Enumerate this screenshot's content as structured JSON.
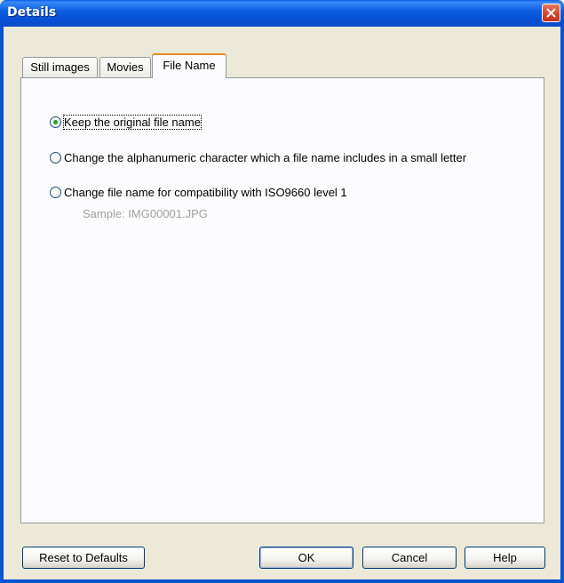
{
  "window": {
    "title": "Details",
    "close_icon": "close-icon"
  },
  "tabs": [
    {
      "label": "Still images",
      "active": false
    },
    {
      "label": "Movies",
      "active": false
    },
    {
      "label": "File Name",
      "active": true
    }
  ],
  "options": [
    {
      "label": "Keep the original file name",
      "checked": true
    },
    {
      "label": "Change the alphanumeric character which a file name includes in a small letter",
      "checked": false
    },
    {
      "label": "Change file name for compatibility with ISO9660 level 1",
      "checked": false
    }
  ],
  "sample_text": "Sample: IMG00001.JPG",
  "buttons": {
    "reset": "Reset to Defaults",
    "ok": "OK",
    "cancel": "Cancel",
    "help": "Help"
  },
  "colors": {
    "titlebar": "#0a5ee8",
    "close_button": "#d6452a",
    "active_tab_accent": "#e68b2c",
    "radio_dot": "#21a121"
  }
}
